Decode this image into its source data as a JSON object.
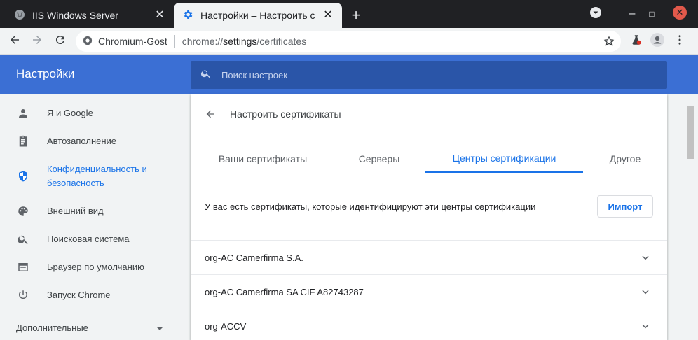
{
  "browser": {
    "tabs": [
      {
        "title": "IIS Windows Server",
        "icon": "globe-icon",
        "active": false
      },
      {
        "title": "Настройки – Настроить с",
        "icon": "gear-icon",
        "active": true
      }
    ],
    "close_glyph": "✕",
    "newtab_glyph": "+",
    "window_controls": {
      "minimize": "–",
      "maximize": "□",
      "close": "✕"
    }
  },
  "omnibox": {
    "site_name": "Chromium-Gost",
    "url_prefix": "chrome://",
    "url_host": "settings",
    "url_path": "/certificates"
  },
  "settings": {
    "title": "Настройки",
    "search_placeholder": "Поиск настроек"
  },
  "sidebar": {
    "items": [
      {
        "label": "Я и Google",
        "icon": "person-icon"
      },
      {
        "label": "Автозаполнение",
        "icon": "clipboard-icon"
      },
      {
        "label": "Конфиденциальность и безопасность",
        "icon": "shield-icon",
        "active": true
      },
      {
        "label": "Внешний вид",
        "icon": "palette-icon"
      },
      {
        "label": "Поисковая система",
        "icon": "search-icon"
      },
      {
        "label": "Браузер по умолчанию",
        "icon": "browser-icon"
      },
      {
        "label": "Запуск Chrome",
        "icon": "power-icon"
      }
    ],
    "advanced_label": "Дополнительные"
  },
  "certificates": {
    "page_title": "Настроить сертификаты",
    "tabs": [
      {
        "label": "Ваши сертификаты"
      },
      {
        "label": "Серверы"
      },
      {
        "label": "Центры сертификации",
        "active": true
      },
      {
        "label": "Другое"
      }
    ],
    "info_text": "У вас есть сертификаты, которые идентифицируют эти центры сертификации",
    "import_label": "Импорт",
    "list": [
      {
        "name": "org-AC Camerfirma S.A."
      },
      {
        "name": "org-AC Camerfirma SA CIF A82743287"
      },
      {
        "name": "org-ACCV"
      }
    ]
  },
  "colors": {
    "accent": "#1a73e8",
    "header_blue": "#3b6fd4",
    "titlebar": "#202124",
    "close_red": "#e2594b"
  }
}
